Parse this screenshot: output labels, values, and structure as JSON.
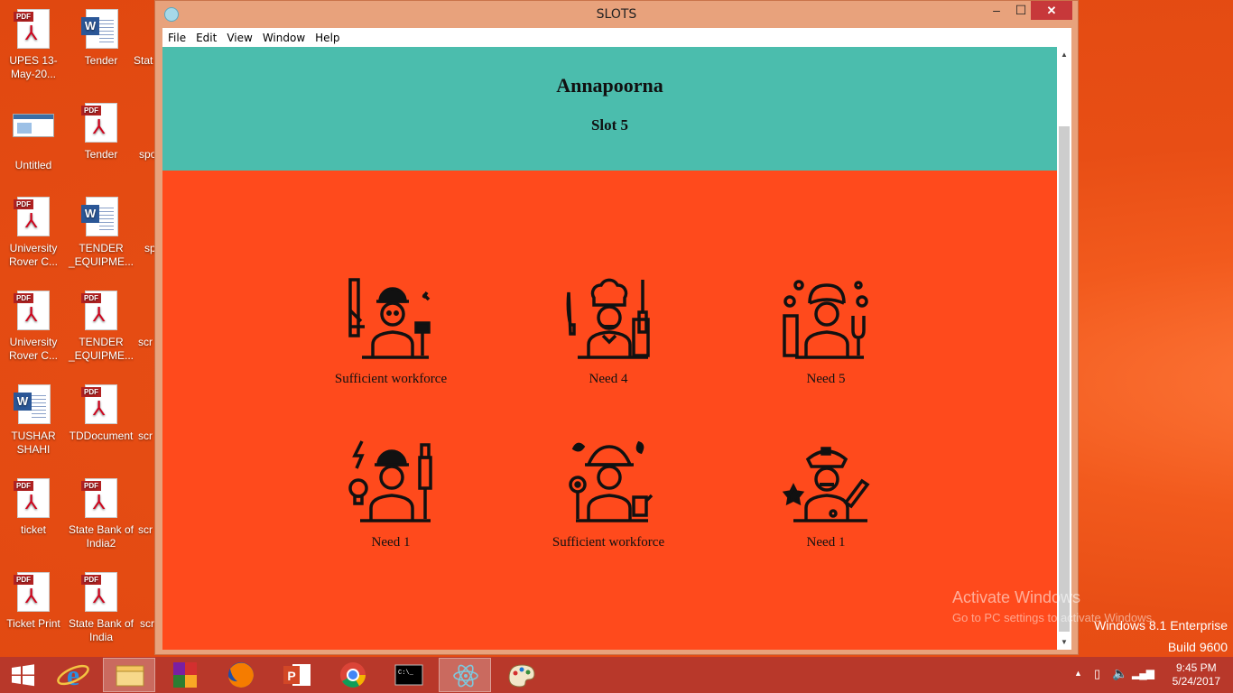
{
  "desktop": {
    "icons": [
      {
        "label": "UPES 13-May-20...",
        "type": "pdf"
      },
      {
        "label": "Tender",
        "type": "word"
      },
      {
        "label": "Untitled",
        "type": "image"
      },
      {
        "label": "Tender",
        "type": "pdf"
      },
      {
        "label": "University Rover C...",
        "type": "pdf"
      },
      {
        "label": "TENDER _EQUIPME...",
        "type": "word"
      },
      {
        "label": "University Rover C...",
        "type": "pdf"
      },
      {
        "label": "TENDER _EQUIPME...",
        "type": "pdf"
      },
      {
        "label": "TUSHAR SHAHI",
        "type": "word"
      },
      {
        "label": "TDDocument",
        "type": "pdf"
      },
      {
        "label": "ticket",
        "type": "pdf"
      },
      {
        "label": "State Bank of India2",
        "type": "pdf"
      },
      {
        "label": "Ticket Print",
        "type": "pdf"
      },
      {
        "label": "State Bank of India",
        "type": "pdf"
      }
    ],
    "partial_labels": [
      "Stat",
      "spo",
      "sp",
      "scr",
      "scr",
      "scr",
      "scr"
    ]
  },
  "window": {
    "title": "SLOTS",
    "menu": [
      "File",
      "Edit",
      "View",
      "Window",
      "Help"
    ],
    "controls": {
      "minimize": "–",
      "maximize": "☐",
      "close": "✕"
    }
  },
  "page": {
    "title": "Annapoorna",
    "subtitle": "Slot 5",
    "header_color": "#4bbdad",
    "body_color": "#ff4a1c",
    "workers": [
      {
        "icon": "construction-worker-icon",
        "label": "Sufficient workforce"
      },
      {
        "icon": "chef-icon",
        "label": "Need 4"
      },
      {
        "icon": "cleaner-icon",
        "label": "Need 5"
      },
      {
        "icon": "electrician-icon",
        "label": "Need 1"
      },
      {
        "icon": "gardener-icon",
        "label": "Sufficient workforce"
      },
      {
        "icon": "police-officer-icon",
        "label": "Need 1"
      }
    ]
  },
  "watermark": {
    "line1": "Activate Windows",
    "line2": "Go to PC settings to activate Windows.",
    "line3": "Windows 8.1 Enterprise",
    "line4": "Build 9600"
  },
  "taskbar": {
    "apps": [
      "start-icon",
      "internet-explorer-icon",
      "file-explorer-icon",
      "winrar-icon",
      "firefox-icon",
      "powerpoint-icon",
      "chrome-icon",
      "command-prompt-icon",
      "electron-app-icon",
      "paint-icon"
    ],
    "time": "9:45 PM",
    "date": "5/24/2017"
  }
}
